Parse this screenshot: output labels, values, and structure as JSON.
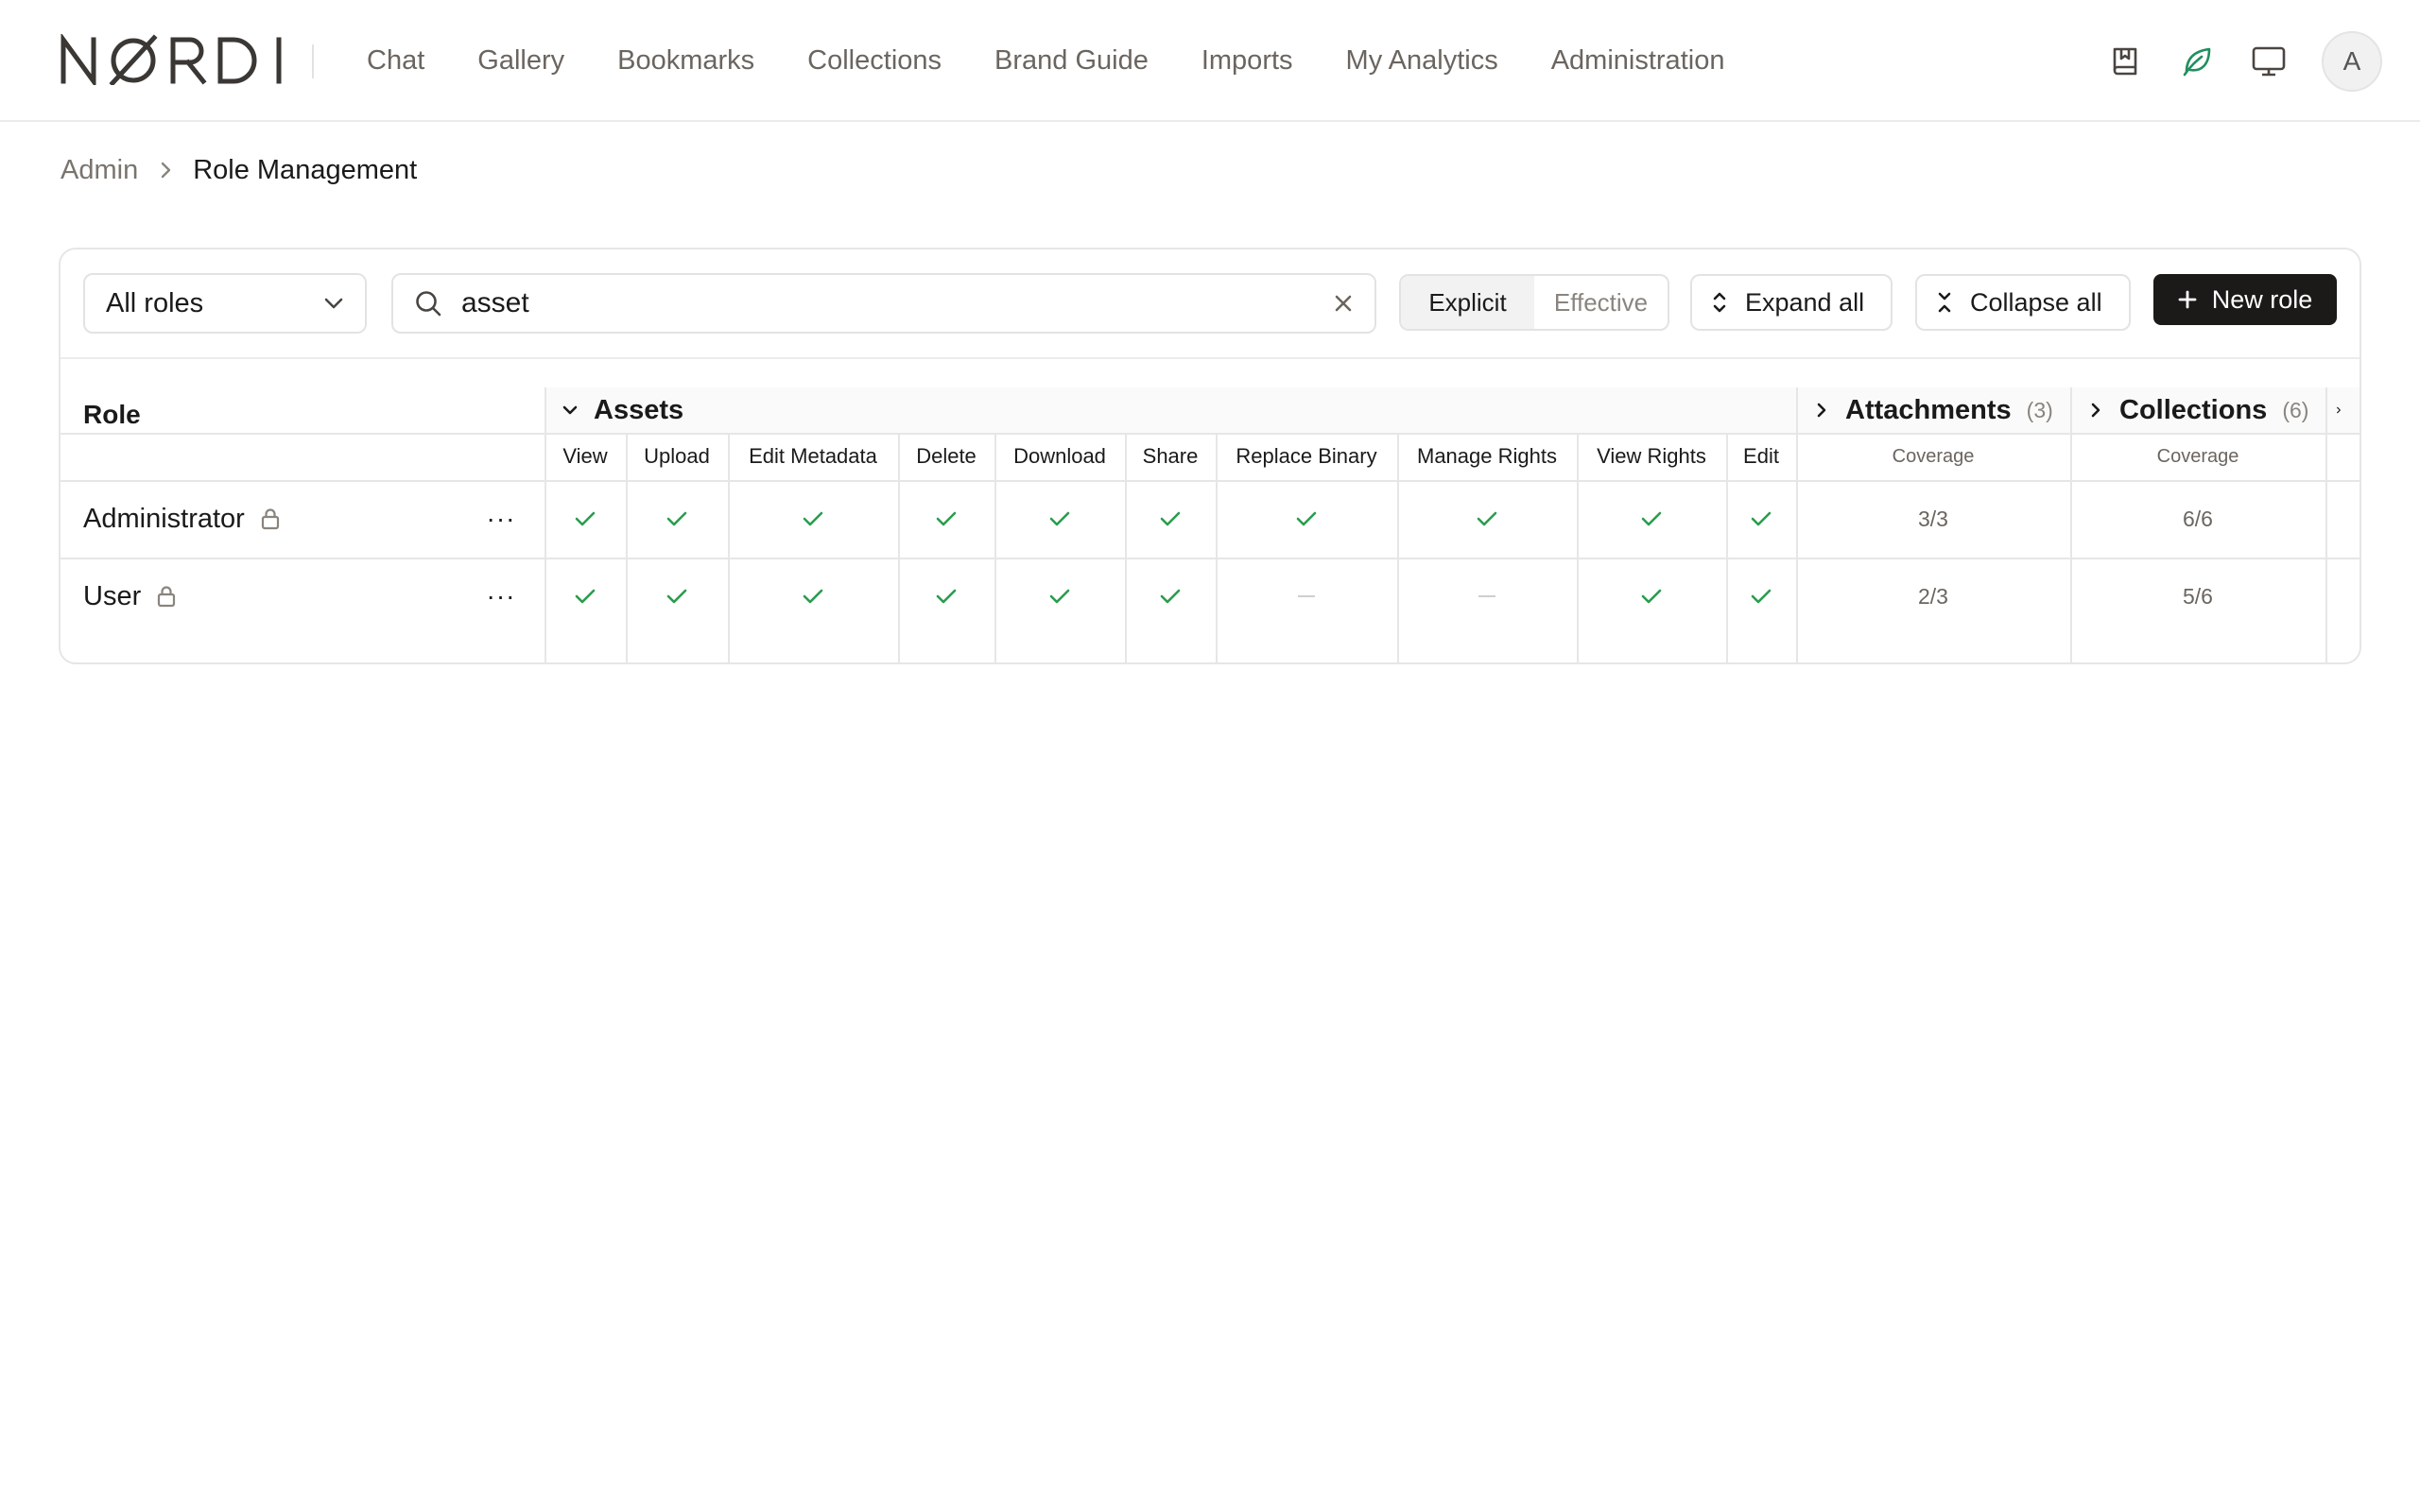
{
  "brand": {
    "logo_text": "NØRDI"
  },
  "nav": {
    "items": [
      {
        "label": "Chat"
      },
      {
        "label": "Gallery"
      },
      {
        "label": "Bookmarks"
      },
      {
        "label": "Collections"
      },
      {
        "label": "Brand Guide"
      },
      {
        "label": "Imports"
      },
      {
        "label": "My Analytics"
      },
      {
        "label": "Administration"
      }
    ]
  },
  "header_icons": [
    "book-icon",
    "leaf-icon",
    "monitor-icon"
  ],
  "user": {
    "avatar_initial": "A"
  },
  "breadcrumb": {
    "parent": "Admin",
    "current": "Role Management"
  },
  "toolbar": {
    "role_filter": "All roles",
    "search_value": "asset",
    "mode_options": [
      "Explicit",
      "Effective"
    ],
    "mode_selected": "Explicit",
    "expand_all": "Expand all",
    "collapse_all": "Collapse all",
    "new_role": "New role"
  },
  "table": {
    "role_header": "Role",
    "groups": [
      {
        "name": "Assets",
        "expanded": true,
        "count": null
      },
      {
        "name": "Attachments",
        "expanded": false,
        "count": "(3)"
      },
      {
        "name": "Collections",
        "expanded": false,
        "count": "(6)"
      }
    ],
    "asset_columns": [
      "View",
      "Upload",
      "Edit Metadata",
      "Delete",
      "Download",
      "Share",
      "Replace Binary",
      "Manage Rights",
      "View Rights",
      "Edit"
    ],
    "coverage_label": "Coverage",
    "rows": [
      {
        "role": "Administrator",
        "locked": true,
        "assets": [
          true,
          true,
          true,
          true,
          true,
          true,
          true,
          true,
          true,
          true
        ],
        "attachments_coverage": "3/3",
        "collections_coverage": "6/6"
      },
      {
        "role": "User",
        "locked": true,
        "assets": [
          true,
          true,
          true,
          true,
          true,
          true,
          false,
          false,
          true,
          true
        ],
        "attachments_coverage": "2/3",
        "collections_coverage": "5/6"
      }
    ]
  },
  "colors": {
    "check": "#2a9d4e",
    "accent_leaf": "#1f8f5f",
    "primary_button": "#1c1a19"
  }
}
